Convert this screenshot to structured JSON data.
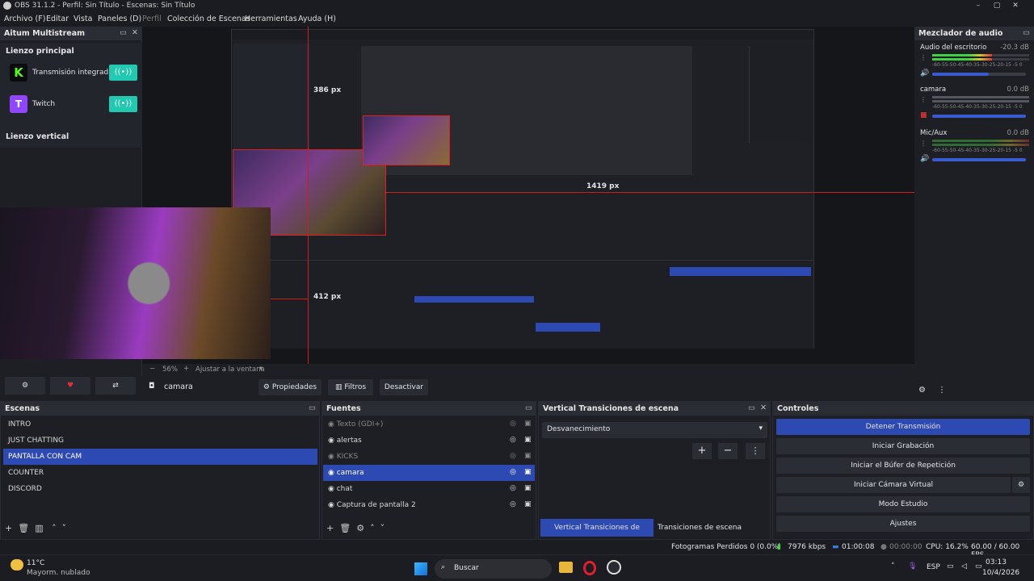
{
  "window": {
    "title": "OBS 31.1.2 - Perfil: Sin Título - Escenas: Sin Título",
    "min": "–",
    "max": "▢",
    "close": "✕"
  },
  "menu": [
    "Archivo (F)",
    "Editar",
    "Vista",
    "Paneles (D)",
    "Perfil",
    "Colección de Escenas",
    "Herramientas",
    "Ayuda (H)"
  ],
  "multistream": {
    "title": "Aitum Multistream",
    "main_canvas": "Lienzo principal",
    "vertical_canvas": "Lienzo vertical",
    "outputs": [
      {
        "name": "Transmisión integrada",
        "badge": "K",
        "color": "#53fc18"
      },
      {
        "name": "Twitch",
        "badge": "T",
        "color": "#9146ff"
      }
    ]
  },
  "preview": {
    "zoom": "56%",
    "fit": "Ajustar a la ventana",
    "labels": {
      "px1": "386 px",
      "px2": "412 px",
      "px3": "1419 px"
    }
  },
  "source_toolbar": {
    "source": "camara",
    "props": "Propiedades",
    "filters": "Filtros",
    "deactivate": "Desactivar"
  },
  "mixer": {
    "title": "Mezclador de audio",
    "channels": [
      {
        "name": "Audio del escritorio",
        "db": "-20.3 dB",
        "level": 0.62,
        "vol": 0.6
      },
      {
        "name": "camara",
        "db": "0.0 dB",
        "level": 0,
        "vol": 1.0
      },
      {
        "name": "Mic/Aux",
        "db": "0.0 dB",
        "level": 0,
        "vol": 1.0
      }
    ],
    "scale": "-60-55-50-45-40-35-30-25-20-15 -5 0"
  },
  "scenes": {
    "title": "Escenas",
    "items": [
      "INTRO",
      "JUST CHATTING",
      "PANTALLA CON CAM",
      "COUNTER",
      "DISCORD"
    ],
    "selected": 2
  },
  "sources": {
    "title": "Fuentes",
    "items": [
      {
        "name": "Texto (GDI+)",
        "dim": true
      },
      {
        "name": "alertas",
        "dim": false
      },
      {
        "name": "KICKS",
        "dim": true
      },
      {
        "name": "camara",
        "dim": false,
        "sel": true
      },
      {
        "name": "chat",
        "dim": false
      },
      {
        "name": "Captura de pantalla 2",
        "dim": false
      }
    ]
  },
  "transitions": {
    "title": "Vertical Transiciones de escena",
    "value": "Desvanecimiento",
    "tab1": "Vertical Transiciones de escena",
    "tab2": "Transiciones de escena"
  },
  "controls": {
    "title": "Controles",
    "buttons": [
      "Detener Transmisión",
      "Iniciar Grabación",
      "Iniciar el Búfer de Repetición",
      "Iniciar Cámara Virtual",
      "Modo Estudio",
      "Ajustes"
    ]
  },
  "status": {
    "dropped": "Fotogramas Perdidos 0 (0.0%)",
    "kbps": "7976 kbps",
    "time_live": "01:00:08",
    "time_rec": "00:00:00",
    "cpu": "CPU: 16.2%",
    "fps": "60.00 / 60.00 FPS"
  },
  "taskbar": {
    "temp": "11°C",
    "weather": "Mayorm. nublado",
    "search": "Buscar",
    "lang": "ESP",
    "time": "03:13",
    "date": "10/4/2026"
  }
}
